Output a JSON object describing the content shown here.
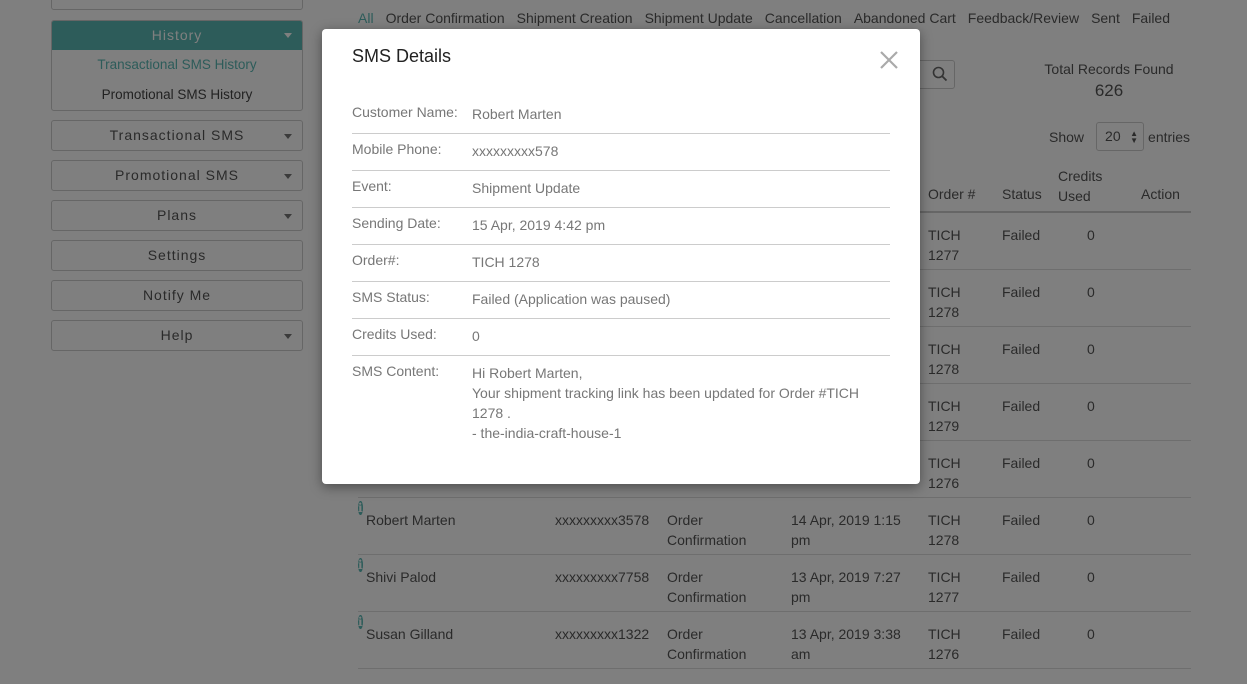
{
  "sidebar": {
    "history_label": "History",
    "history_items": [
      "Transactional SMS History",
      "Promotional SMS History"
    ],
    "buttons": [
      "Transactional SMS",
      "Promotional SMS",
      "Plans",
      "Settings",
      "Notify Me",
      "Help"
    ]
  },
  "tabs": [
    "All",
    "Order Confirmation",
    "Shipment Creation",
    "Shipment Update",
    "Cancellation",
    "Abandoned Cart",
    "Feedback/Review",
    "Sent",
    "Failed"
  ],
  "total": {
    "label": "Total Records Found",
    "value": "626"
  },
  "show": {
    "label_before": "Show",
    "value": "20",
    "label_after": "entries"
  },
  "table": {
    "headers": {
      "order": "Order #",
      "status": "Status",
      "credits": "Credits Used",
      "action": "Action"
    },
    "rows": [
      {
        "name": "",
        "mobile": "",
        "event": "",
        "date": "",
        "order": "TICH 1277",
        "status": "Failed",
        "credits": "0"
      },
      {
        "name": "",
        "mobile": "",
        "event": "",
        "date": "",
        "order": "TICH 1278",
        "status": "Failed",
        "credits": "0"
      },
      {
        "name": "",
        "mobile": "",
        "event": "",
        "date": "",
        "order": "TICH 1278",
        "status": "Failed",
        "credits": "0"
      },
      {
        "name": "",
        "mobile": "",
        "event": "",
        "date": "",
        "order": "TICH 1279",
        "status": "Failed",
        "credits": "0"
      },
      {
        "name": "",
        "mobile": "",
        "event": "",
        "date": "",
        "order": "TICH 1276",
        "status": "Failed",
        "credits": "0"
      },
      {
        "name": "Robert Marten",
        "mobile": "xxxxxxxxx3578",
        "event": "Order Confirmation",
        "date": "14 Apr, 2019 1:15 pm",
        "order": "TICH 1278",
        "status": "Failed",
        "credits": "0"
      },
      {
        "name": "Shivi Palod",
        "mobile": "xxxxxxxxx7758",
        "event": "Order Confirmation",
        "date": "13 Apr, 2019 7:27 pm",
        "order": "TICH 1277",
        "status": "Failed",
        "credits": "0"
      },
      {
        "name": "Susan Gilland",
        "mobile": "xxxxxxxxx1322",
        "event": "Order Confirmation",
        "date": "13 Apr, 2019 3:38 am",
        "order": "TICH 1276",
        "status": "Failed",
        "credits": "0"
      }
    ]
  },
  "modal": {
    "title": "SMS Details",
    "fields": [
      {
        "label": "Customer Name:",
        "value": "Robert Marten"
      },
      {
        "label": "Mobile Phone:",
        "value": "xxxxxxxxx578"
      },
      {
        "label": "Event:",
        "value": "Shipment Update"
      },
      {
        "label": "Sending Date:",
        "value": "15 Apr, 2019 4:42 pm"
      },
      {
        "label": "Order#:",
        "value": "TICH 1278"
      },
      {
        "label": "SMS Status:",
        "value": "Failed (Application was paused)"
      },
      {
        "label": "Credits Used:",
        "value": "0"
      }
    ],
    "content_label": "SMS Content:",
    "content_lines": [
      "Hi Robert Marten,",
      "Your shipment tracking link has been updated for Order #TICH 1278 .",
      "- the-india-craft-house-1"
    ]
  },
  "colors": {
    "accent": "#5bb8b4",
    "overlay": "rgba(0,0,0,0.5)"
  },
  "icons": {
    "search": "search-icon",
    "close": "close-icon",
    "info": "info-icon",
    "caret": "caret-down-icon"
  }
}
